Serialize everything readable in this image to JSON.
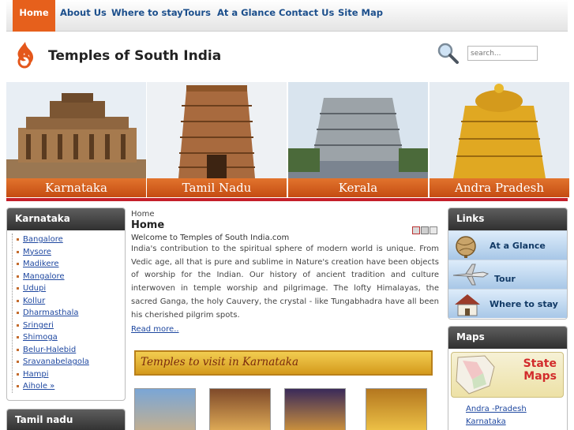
{
  "nav": {
    "items": [
      {
        "label": "Home"
      },
      {
        "label": "About Us"
      },
      {
        "label": "Where to stay"
      },
      {
        "label": "Tours"
      },
      {
        "label": "At a Glance"
      },
      {
        "label": "Contact Us"
      },
      {
        "label": "Site Map"
      }
    ],
    "active_index": 0
  },
  "header": {
    "title": "Temples of South India",
    "search_placeholder": "search..."
  },
  "banner": {
    "panels": [
      {
        "caption": "Karnataka"
      },
      {
        "caption": "Tamil Nadu"
      },
      {
        "caption": "Kerala"
      },
      {
        "caption": "Andra Pradesh"
      }
    ]
  },
  "left_sidebar": {
    "karnataka": {
      "title": "Karnataka",
      "items": [
        "Bangalore",
        "Mysore",
        "Madikere",
        "Mangalore",
        "Udupi",
        "Kollur",
        "Dharmasthala",
        "Sringeri",
        "Shimoga",
        "Belur-Halebid",
        "Sravanabelagola",
        "Hampi",
        "Aihole »"
      ]
    },
    "tamil_nadu": {
      "title": "Tamil nadu"
    }
  },
  "main": {
    "breadcrumb": "Home",
    "title": "Home",
    "welcome": "Welcome to Temples of South India.com",
    "paragraph": "India's contribution to the spiritual sphere of modern world is unique. From Vedic age, all that is pure and sublime in Nature's creation have been objects of worship for the Indian. Our history of ancient tradition and culture interwoven in temple worship and pilgrimage. The lofty Himalayas, the sacred Ganga, the holy Cauvery, the crystal - like Tungabhadra have all been his cherished pilgrim spots.",
    "read_more": "Read more..",
    "visit_banner": "Temples to visit in Karnataka"
  },
  "right_sidebar": {
    "links": {
      "title": "Links",
      "items": [
        {
          "label": "At a Glance",
          "icon": "globe-icon"
        },
        {
          "label": "Tour",
          "icon": "airplane-icon"
        },
        {
          "label": "Where to stay",
          "icon": "house-icon"
        }
      ]
    },
    "maps": {
      "title": "Maps",
      "image_text_1": "State",
      "image_text_2": "Maps",
      "links": [
        "Andra -Pradesh",
        "Karnataka"
      ]
    }
  },
  "colors": {
    "nav_active": "#e6601c",
    "nav_text": "#1c4f8c",
    "banner_caption": "#d25a1a",
    "divider_red": "#c4202a",
    "link_blue": "#1f48a0"
  }
}
